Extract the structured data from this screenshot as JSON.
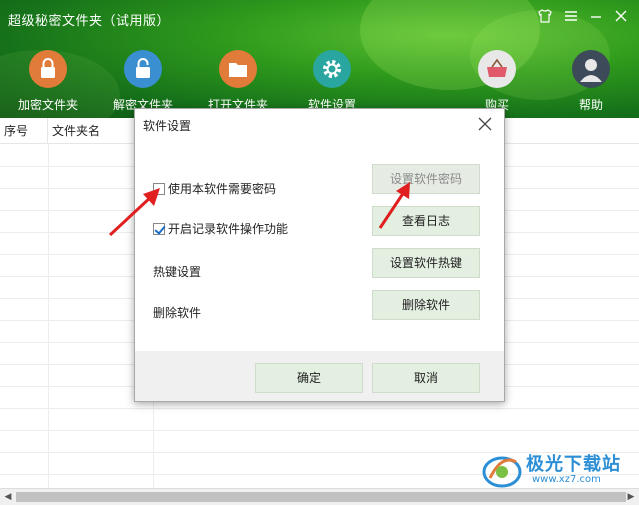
{
  "app": {
    "title": "超级秘密文件夹（试用版）"
  },
  "window_controls": {
    "skin_icon": "shirt-icon",
    "menu_icon": "menu-icon",
    "minimize_icon": "minimize-icon",
    "close_icon": "close-icon"
  },
  "toolbar": {
    "items": [
      {
        "label": "加密文件夹",
        "icon": "lock-icon",
        "color": "#e07b3a"
      },
      {
        "label": "解密文件夹",
        "icon": "unlock-icon",
        "color": "#3a8fd0"
      },
      {
        "label": "打开文件夹",
        "icon": "folder-icon",
        "color": "#e07b3a"
      },
      {
        "label": "软件设置",
        "icon": "gear-icon",
        "color": "#2aa6a0"
      },
      {
        "label": "购买",
        "icon": "basket-icon",
        "color": "#e05a6a"
      },
      {
        "label": "帮助",
        "icon": "user-icon",
        "color": "#3c4a5a"
      }
    ]
  },
  "table": {
    "columns": [
      "序号",
      "文件夹名"
    ]
  },
  "dialog": {
    "title": "软件设置",
    "options": [
      {
        "label": "使用本软件需要密码",
        "checked": false,
        "button": "设置软件密码",
        "button_enabled": false
      },
      {
        "label": "开启记录软件操作功能",
        "checked": true,
        "button": "查看日志",
        "button_enabled": true
      },
      {
        "label": "热键设置",
        "button": "设置软件热键",
        "button_enabled": true
      },
      {
        "label": "删除软件",
        "button": "删除软件",
        "button_enabled": true
      }
    ],
    "ok_label": "确定",
    "cancel_label": "取消"
  },
  "watermark": {
    "brand": "极光下载站",
    "url": "www.xz7.com"
  },
  "colors": {
    "header_green": "#2f9a1c",
    "button_bg": "#e3efe0",
    "arrow_red": "#e02020",
    "watermark_blue": "#2c8fd6"
  }
}
